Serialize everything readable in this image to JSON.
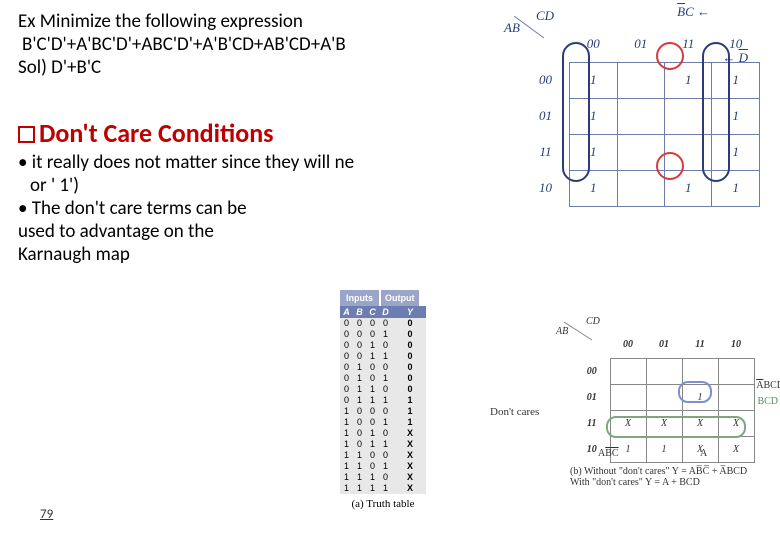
{
  "text": {
    "ex_line1": "Ex  Minimize the following expression",
    "ex_line2": "B'C'D'+A'BC'D'+ABC'D'+A'B'CD+AB'CD+A'B",
    "ex_line3": "Sol) D'+B'C",
    "heading": "Don't Care Conditions",
    "bullet1a": "• it really does not matter since they will ne",
    "bullet1b": "or ' 1')",
    "bullet2": "• The don't care terms can be",
    "bullet3": "used to advantage on the",
    "bullet4": "Karnaugh map",
    "pagenum": "79"
  },
  "big_kmap": {
    "top_var": "CD",
    "left_var": "AB",
    "col_labels": [
      "00",
      "01",
      "11",
      "10"
    ],
    "row_labels": [
      "00",
      "01",
      "11",
      "10"
    ],
    "bar_bc_html": "B̅C",
    "bar_d": "D̅",
    "cells": [
      [
        "1",
        "",
        "1",
        "1"
      ],
      [
        "1",
        "",
        "",
        "1"
      ],
      [
        "1",
        "",
        "",
        "1"
      ],
      [
        "1",
        "",
        "1",
        "1"
      ]
    ]
  },
  "truth_table": {
    "hdr_inputs": "Inputs",
    "hdr_output": "Output",
    "sub": [
      "A",
      "B",
      "C",
      "D",
      "Y"
    ],
    "rows": [
      [
        "0",
        "0",
        "0",
        "0",
        "0"
      ],
      [
        "0",
        "0",
        "0",
        "1",
        "0"
      ],
      [
        "0",
        "0",
        "1",
        "0",
        "0"
      ],
      [
        "0",
        "0",
        "1",
        "1",
        "0"
      ],
      [
        "0",
        "1",
        "0",
        "0",
        "0"
      ],
      [
        "0",
        "1",
        "0",
        "1",
        "0"
      ],
      [
        "0",
        "1",
        "1",
        "0",
        "0"
      ],
      [
        "0",
        "1",
        "1",
        "1",
        "1"
      ],
      [
        "1",
        "0",
        "0",
        "0",
        "1"
      ],
      [
        "1",
        "0",
        "0",
        "1",
        "1"
      ],
      [
        "1",
        "0",
        "1",
        "0",
        "X"
      ],
      [
        "1",
        "0",
        "1",
        "1",
        "X"
      ],
      [
        "1",
        "1",
        "0",
        "0",
        "X"
      ],
      [
        "1",
        "1",
        "0",
        "1",
        "X"
      ],
      [
        "1",
        "1",
        "1",
        "0",
        "X"
      ],
      [
        "1",
        "1",
        "1",
        "1",
        "X"
      ]
    ],
    "caption": "(a) Truth table"
  },
  "small_kmap": {
    "top_var": "CD",
    "left_var": "AB",
    "col_labels": [
      "00",
      "01",
      "11",
      "10"
    ],
    "row_labels": [
      "00",
      "01",
      "11",
      "10"
    ],
    "cells": [
      [
        "",
        "",
        "",
        ""
      ],
      [
        "",
        "",
        "1",
        ""
      ],
      [
        "X",
        "X",
        "X",
        "X"
      ],
      [
        "1",
        "1",
        "X",
        "X"
      ]
    ],
    "dont_cares_label": "Don't cares",
    "label_abcd": "A̅BCD",
    "label_bcd": "BCD",
    "label_abc": "AB̅C̅",
    "label_a": "A",
    "caption": "(b)  Without \"don't cares\"  Y = AB̅C̅ + A̅BCD\n      With \"don't cares\"      Y = A + BCD"
  }
}
